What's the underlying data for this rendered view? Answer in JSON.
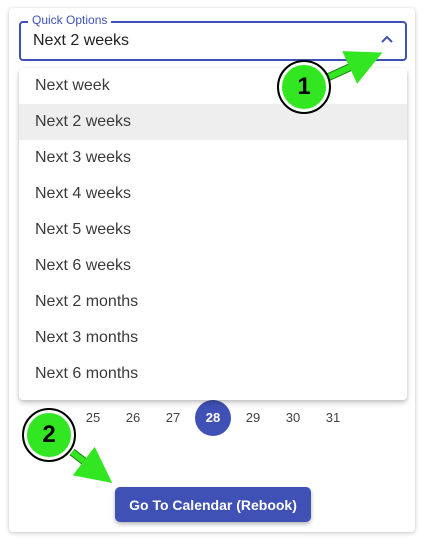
{
  "quick_options": {
    "label": "Quick Options",
    "value": "Next 2 weeks",
    "options": [
      "Next week",
      "Next 2 weeks",
      "Next 3 weeks",
      "Next 4 weeks",
      "Next 5 weeks",
      "Next 6 weeks",
      "Next 2 months",
      "Next 3 months",
      "Next 6 months"
    ],
    "selected_index": 1
  },
  "calendar": {
    "days": [
      "25",
      "26",
      "27",
      "28",
      "29",
      "30",
      "31"
    ],
    "active_day": "28"
  },
  "button": {
    "label": "Go To Calendar (Rebook)"
  },
  "annotations": {
    "badge1": "1",
    "badge2": "2"
  },
  "colors": {
    "accent": "#3f51b5",
    "annotation_green": "#33e622"
  }
}
